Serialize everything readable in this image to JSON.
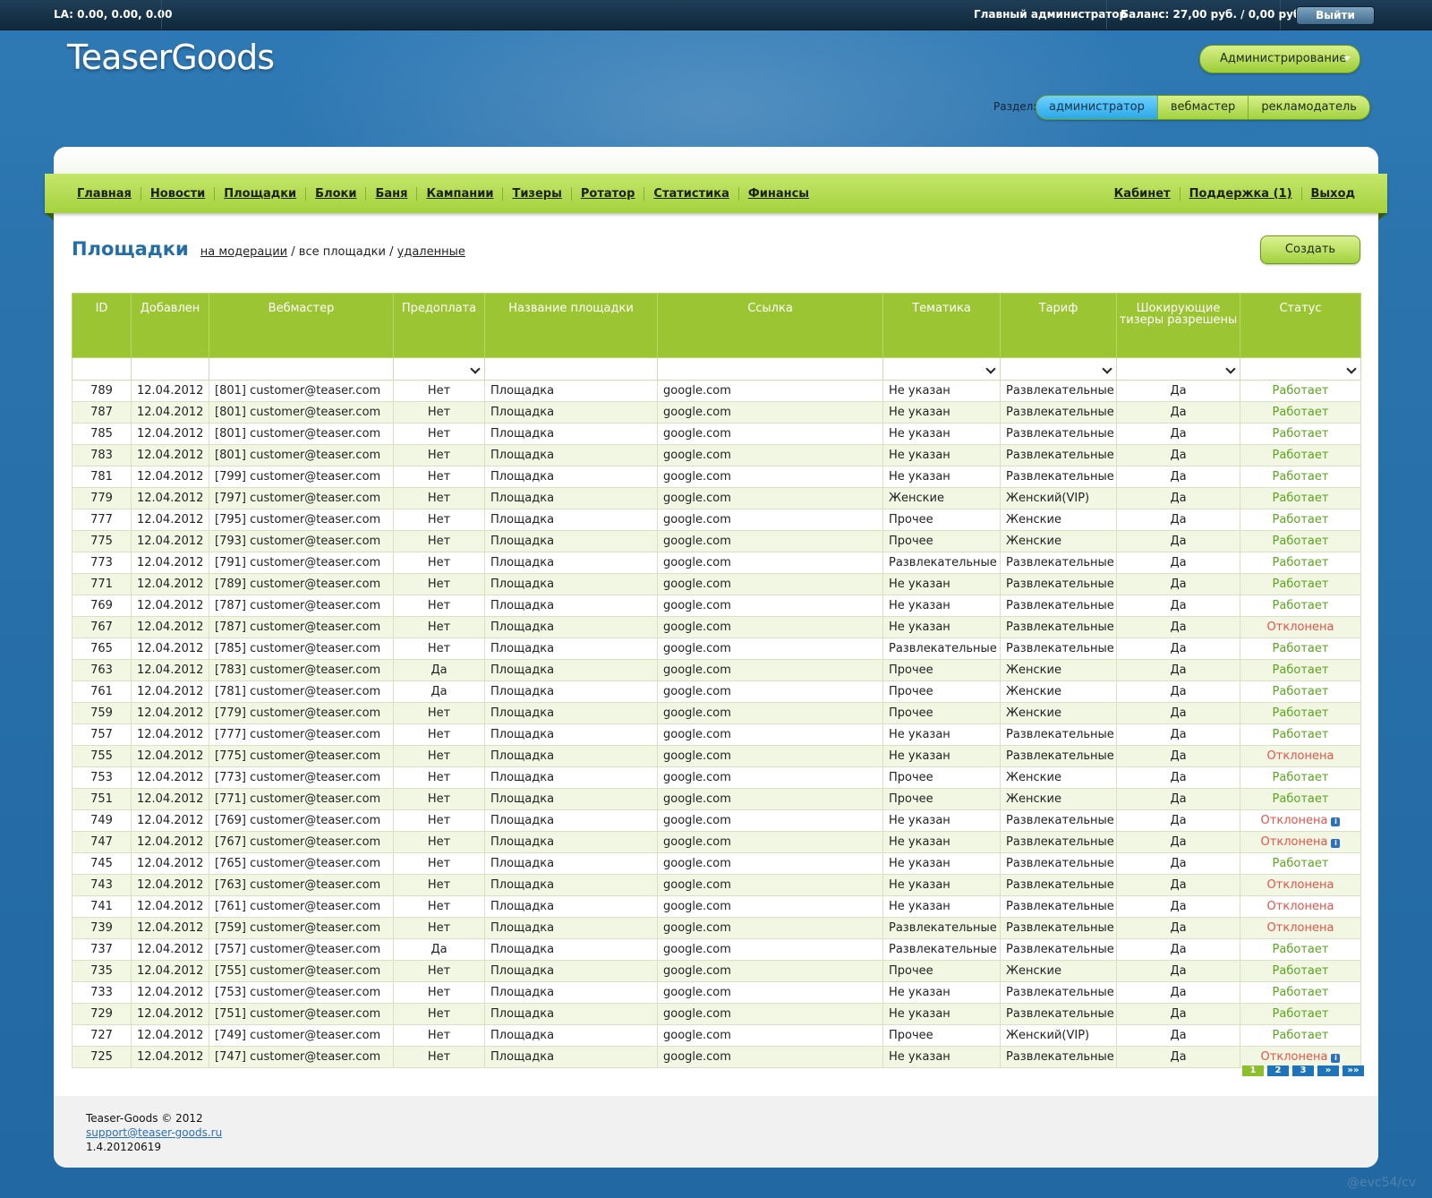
{
  "topbar": {
    "la": "LA: 0.00, 0.00, 0.00",
    "role": "Главный администратор",
    "balance": "Баланс: 27,00 руб. / 0,00 руб.",
    "logout": "Выйти"
  },
  "logo": "TeaserGoods",
  "admin_menu": "Администрирование",
  "section": {
    "label": "Раздел:",
    "tabs": [
      "администратор",
      "вебмастер",
      "рекламодатель"
    ],
    "active": "администратор"
  },
  "nav": {
    "left": [
      "Главная",
      "Новости",
      "Площадки",
      "Блоки",
      "Баня",
      "Кампании",
      "Тизеры",
      "Ротатор",
      "Статистика",
      "Финансы"
    ],
    "right": [
      "Кабинет",
      "Поддержка (1)",
      "Выход"
    ]
  },
  "page": {
    "title": "Площадки",
    "crumb_moderation": "на модерации",
    "crumb_sep1": "/",
    "crumb_all": "все площадки",
    "crumb_sep2": "/",
    "crumb_deleted": "удаленные",
    "create": "Создать"
  },
  "table": {
    "headers": [
      "ID",
      "Добавлен",
      "Вебмастер",
      "Предоплата",
      "Название площадки",
      "Ссылка",
      "Тематика",
      "Тариф",
      "Шокирующие тизеры разрешены",
      "Статус"
    ],
    "rows": [
      [
        "789",
        "12.04.2012",
        "[801] customer@teaser.com",
        "Нет",
        "Площадка",
        "google.com",
        "Не указан",
        "Развлекательные",
        "Да",
        "Работает"
      ],
      [
        "787",
        "12.04.2012",
        "[801] customer@teaser.com",
        "Нет",
        "Площадка",
        "google.com",
        "Не указан",
        "Развлекательные",
        "Да",
        "Работает"
      ],
      [
        "785",
        "12.04.2012",
        "[801] customer@teaser.com",
        "Нет",
        "Площадка",
        "google.com",
        "Не указан",
        "Развлекательные",
        "Да",
        "Работает"
      ],
      [
        "783",
        "12.04.2012",
        "[801] customer@teaser.com",
        "Нет",
        "Площадка",
        "google.com",
        "Не указан",
        "Развлекательные",
        "Да",
        "Работает"
      ],
      [
        "781",
        "12.04.2012",
        "[799] customer@teaser.com",
        "Нет",
        "Площадка",
        "google.com",
        "Не указан",
        "Развлекательные",
        "Да",
        "Работает"
      ],
      [
        "779",
        "12.04.2012",
        "[797] customer@teaser.com",
        "Нет",
        "Площадка",
        "google.com",
        "Женские",
        "Женский(VIP)",
        "Да",
        "Работает"
      ],
      [
        "777",
        "12.04.2012",
        "[795] customer@teaser.com",
        "Нет",
        "Площадка",
        "google.com",
        "Прочее",
        "Женские",
        "Да",
        "Работает"
      ],
      [
        "775",
        "12.04.2012",
        "[793] customer@teaser.com",
        "Нет",
        "Площадка",
        "google.com",
        "Прочее",
        "Женские",
        "Да",
        "Работает"
      ],
      [
        "773",
        "12.04.2012",
        "[791] customer@teaser.com",
        "Нет",
        "Площадка",
        "google.com",
        "Развлекательные",
        "Развлекательные",
        "Да",
        "Работает"
      ],
      [
        "771",
        "12.04.2012",
        "[789] customer@teaser.com",
        "Нет",
        "Площадка",
        "google.com",
        "Не указан",
        "Развлекательные",
        "Да",
        "Работает"
      ],
      [
        "769",
        "12.04.2012",
        "[787] customer@teaser.com",
        "Нет",
        "Площадка",
        "google.com",
        "Не указан",
        "Развлекательные",
        "Да",
        "Работает"
      ],
      [
        "767",
        "12.04.2012",
        "[787] customer@teaser.com",
        "Нет",
        "Площадка",
        "google.com",
        "Не указан",
        "Развлекательные",
        "Да",
        "Отклонена"
      ],
      [
        "765",
        "12.04.2012",
        "[785] customer@teaser.com",
        "Нет",
        "Площадка",
        "google.com",
        "Развлекательные",
        "Развлекательные",
        "Да",
        "Работает"
      ],
      [
        "763",
        "12.04.2012",
        "[783] customer@teaser.com",
        "Да",
        "Площадка",
        "google.com",
        "Прочее",
        "Женские",
        "Да",
        "Работает"
      ],
      [
        "761",
        "12.04.2012",
        "[781] customer@teaser.com",
        "Да",
        "Площадка",
        "google.com",
        "Прочее",
        "Женские",
        "Да",
        "Работает"
      ],
      [
        "759",
        "12.04.2012",
        "[779] customer@teaser.com",
        "Нет",
        "Площадка",
        "google.com",
        "Прочее",
        "Женские",
        "Да",
        "Работает"
      ],
      [
        "757",
        "12.04.2012",
        "[777] customer@teaser.com",
        "Нет",
        "Площадка",
        "google.com",
        "Не указан",
        "Развлекательные",
        "Да",
        "Работает"
      ],
      [
        "755",
        "12.04.2012",
        "[775] customer@teaser.com",
        "Нет",
        "Площадка",
        "google.com",
        "Не указан",
        "Развлекательные",
        "Да",
        "Отклонена"
      ],
      [
        "753",
        "12.04.2012",
        "[773] customer@teaser.com",
        "Нет",
        "Площадка",
        "google.com",
        "Прочее",
        "Женские",
        "Да",
        "Работает"
      ],
      [
        "751",
        "12.04.2012",
        "[771] customer@teaser.com",
        "Нет",
        "Площадка",
        "google.com",
        "Прочее",
        "Женские",
        "Да",
        "Работает"
      ],
      [
        "749",
        "12.04.2012",
        "[769] customer@teaser.com",
        "Нет",
        "Площадка",
        "google.com",
        "Не указан",
        "Развлекательные",
        "Да",
        "Отклонена"
      ],
      [
        "747",
        "12.04.2012",
        "[767] customer@teaser.com",
        "Нет",
        "Площадка",
        "google.com",
        "Не указан",
        "Развлекательные",
        "Да",
        "Отклонена"
      ],
      [
        "745",
        "12.04.2012",
        "[765] customer@teaser.com",
        "Нет",
        "Площадка",
        "google.com",
        "Не указан",
        "Развлекательные",
        "Да",
        "Работает"
      ],
      [
        "743",
        "12.04.2012",
        "[763] customer@teaser.com",
        "Нет",
        "Площадка",
        "google.com",
        "Не указан",
        "Развлекательные",
        "Да",
        "Отклонена"
      ],
      [
        "741",
        "12.04.2012",
        "[761] customer@teaser.com",
        "Нет",
        "Площадка",
        "google.com",
        "Не указан",
        "Развлекательные",
        "Да",
        "Отклонена"
      ],
      [
        "739",
        "12.04.2012",
        "[759] customer@teaser.com",
        "Нет",
        "Площадка",
        "google.com",
        "Развлекательные",
        "Развлекательные",
        "Да",
        "Отклонена"
      ],
      [
        "737",
        "12.04.2012",
        "[757] customer@teaser.com",
        "Да",
        "Площадка",
        "google.com",
        "Развлекательные",
        "Развлекательные",
        "Да",
        "Работает"
      ],
      [
        "735",
        "12.04.2012",
        "[755] customer@teaser.com",
        "Нет",
        "Площадка",
        "google.com",
        "Прочее",
        "Женские",
        "Да",
        "Работает"
      ],
      [
        "733",
        "12.04.2012",
        "[753] customer@teaser.com",
        "Нет",
        "Площадка",
        "google.com",
        "Не указан",
        "Развлекательные",
        "Да",
        "Работает"
      ],
      [
        "729",
        "12.04.2012",
        "[751] customer@teaser.com",
        "Нет",
        "Площадка",
        "google.com",
        "Не указан",
        "Развлекательные",
        "Да",
        "Работает"
      ],
      [
        "727",
        "12.04.2012",
        "[749] customer@teaser.com",
        "Нет",
        "Площадка",
        "google.com",
        "Прочее",
        "Женский(VIP)",
        "Да",
        "Работает"
      ],
      [
        "725",
        "12.04.2012",
        "[747] customer@teaser.com",
        "Нет",
        "Площадка",
        "google.com",
        "Не указан",
        "Развлекательные",
        "Да",
        "Отклонена"
      ]
    ],
    "info_rows": [
      "749",
      "747",
      "725"
    ]
  },
  "pager": [
    "1",
    "2",
    "3",
    "»",
    "»»"
  ],
  "footer": {
    "copyright": "Teaser-Goods © 2012",
    "email": "support@teaser-goods.ru",
    "version": "1.4.20120619"
  },
  "watermark": "@evc54/cv",
  "colors": {
    "ok": "#5aa51c",
    "rejected": "#e4534a",
    "accent": "#9cc534",
    "brand_blue": "#246ea8"
  }
}
